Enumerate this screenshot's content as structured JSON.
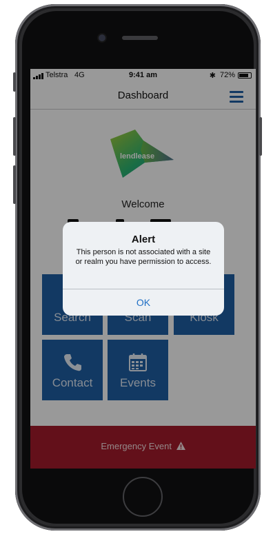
{
  "status_bar": {
    "carrier": "Telstra",
    "network": "4G",
    "time": "9:41 am",
    "bluetooth_icon": "bluetooth-icon",
    "battery_percent": "72%"
  },
  "nav": {
    "title": "Dashboard",
    "menu_icon": "hamburger-menu-icon"
  },
  "logo": {
    "text": "lendlease"
  },
  "welcome": "Welcome",
  "tiles": [
    {
      "label": "Search",
      "icon": "search-icon"
    },
    {
      "label": "Scan",
      "icon": "scan-icon"
    },
    {
      "label": "Kiosk",
      "icon": "kiosk-icon"
    },
    {
      "label": "Contact",
      "icon": "phone-icon"
    },
    {
      "label": "Events",
      "icon": "calendar-icon"
    }
  ],
  "emergency": {
    "label": "Emergency Event",
    "icon": "warning-icon"
  },
  "alert": {
    "title": "Alert",
    "message": "This person is not associated with a site or realm you have permission to access.",
    "ok_label": "OK"
  },
  "colors": {
    "primary_blue": "#1f5fa6",
    "emergency_red": "#a51c2c",
    "alert_button": "#1f6fc5"
  }
}
